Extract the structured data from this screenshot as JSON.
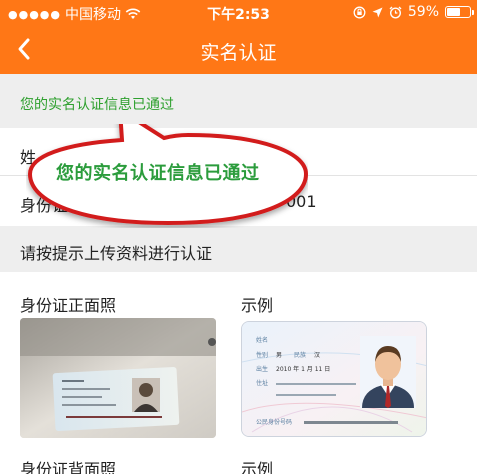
{
  "status_bar": {
    "carrier": "中国移动",
    "time": "下午2:53",
    "battery_percent": "59%",
    "battery_level": 0.59,
    "icons": [
      "signal-dots-icon",
      "wifi-icon",
      "rotation-lock-icon",
      "location-arrow-icon",
      "alarm-icon",
      "battery-icon"
    ]
  },
  "navbar": {
    "back_icon": "chevron-left-icon",
    "title": "实名认证"
  },
  "notice": {
    "text": "您的实名认证信息已通过"
  },
  "fields": {
    "name_label": "姓",
    "id_label": "身份证",
    "id_value_tail": "001"
  },
  "section": {
    "title": "请按提示上传资料进行认证"
  },
  "front": {
    "label": "身份证正面照",
    "example_label": "示例",
    "sample_lines": [
      "姓名",
      "性别",
      "男",
      "民族",
      "汉",
      "出生",
      "2010  年  1  月  11  日",
      "住址",
      "公民身份号码"
    ]
  },
  "back": {
    "label": "身份证背面照",
    "example_label": "示例"
  },
  "callout": {
    "text": "您的实名认证信息已通过"
  },
  "colors": {
    "brand_orange": "#ff7716",
    "success_green": "#2ea02e",
    "callout_border": "#d21f1f",
    "section_gray": "#eeeeee"
  }
}
